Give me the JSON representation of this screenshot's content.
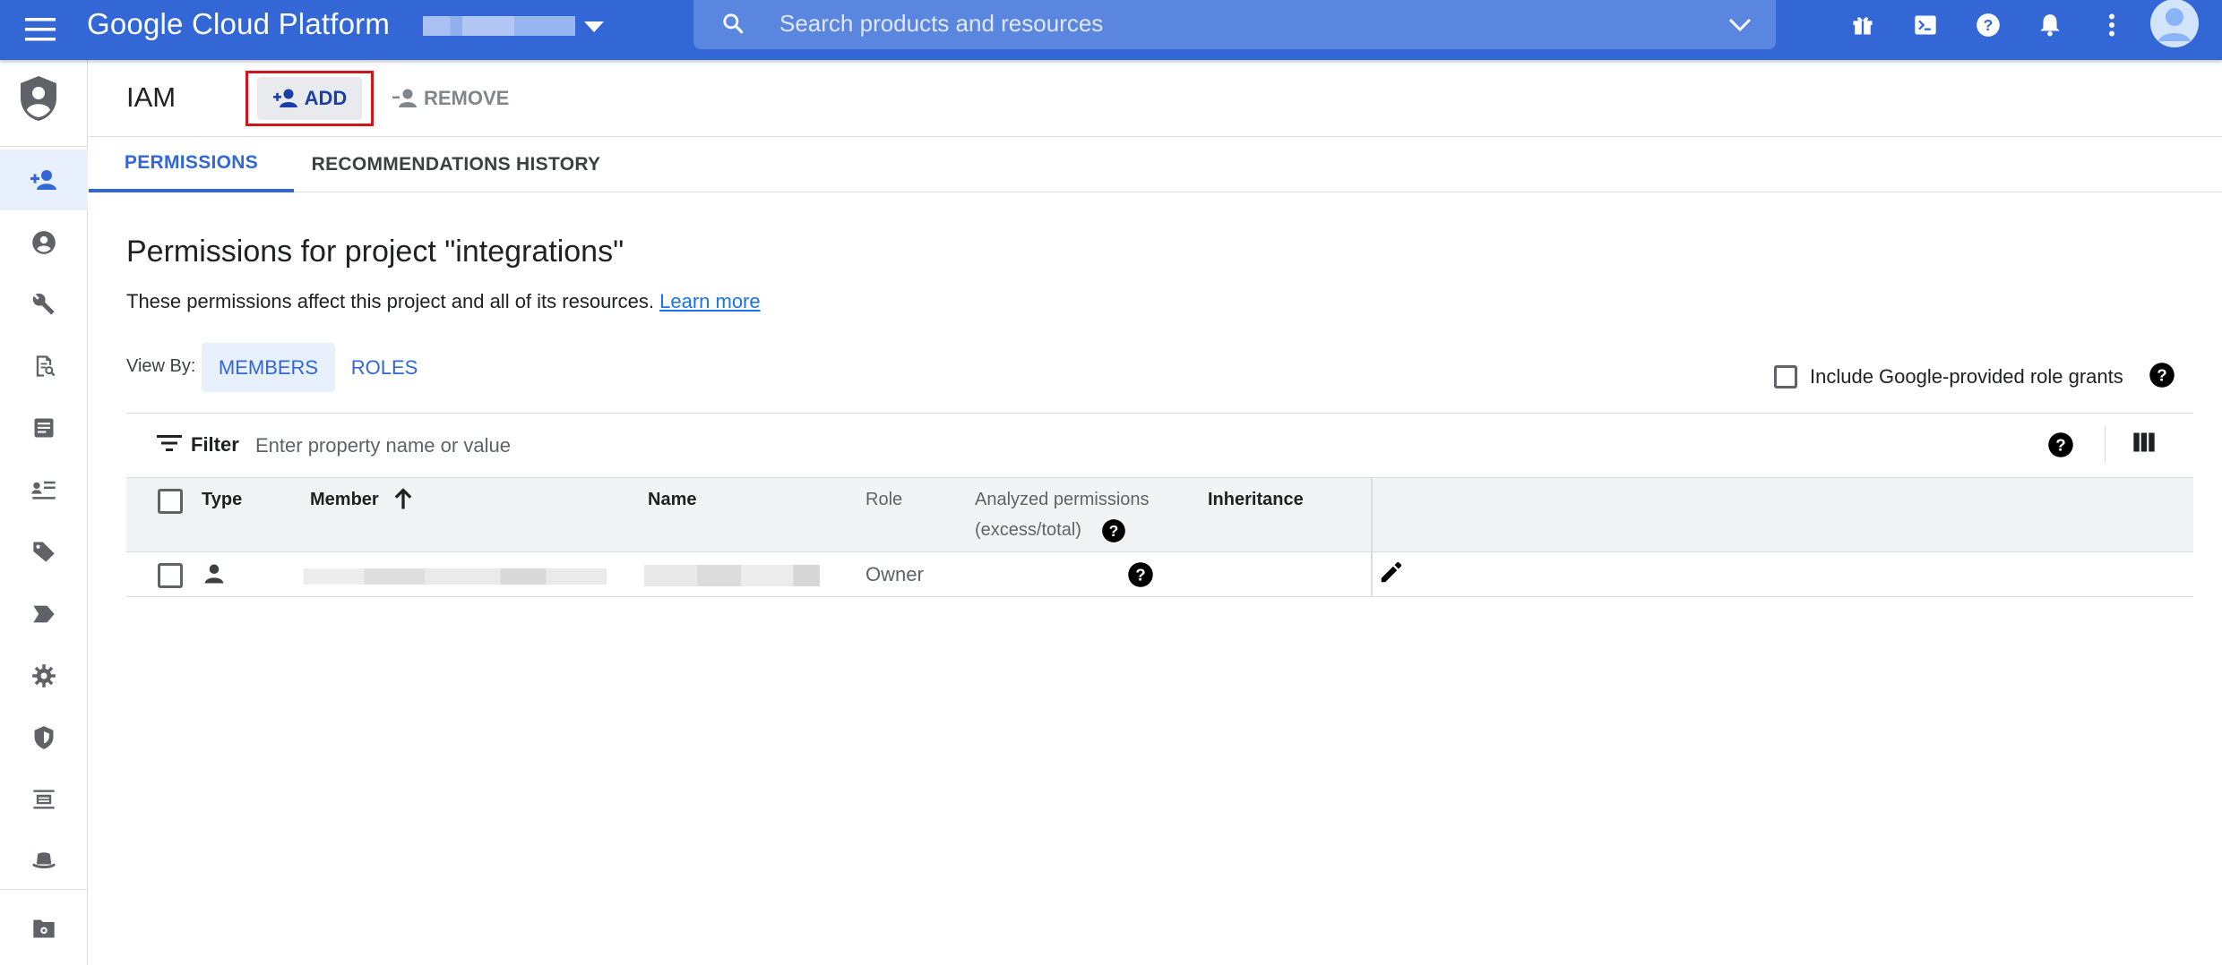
{
  "topbar": {
    "brand": "Google Cloud Platform",
    "search_placeholder": "Search products and resources"
  },
  "actions": {
    "page_title": "IAM",
    "add_label": "ADD",
    "remove_label": "REMOVE"
  },
  "tabs": [
    {
      "label": "PERMISSIONS",
      "active": true
    },
    {
      "label": "RECOMMENDATIONS HISTORY",
      "active": false
    }
  ],
  "content": {
    "heading": "Permissions for project \"integrations\"",
    "description": "These permissions affect this project and all of its resources.",
    "learn_more": "Learn more",
    "view_by_label": "View By:",
    "view_by_options": [
      "MEMBERS",
      "ROLES"
    ],
    "view_by_selected": "MEMBERS",
    "include_label": "Include Google-provided role grants",
    "include_checked": false
  },
  "filter": {
    "label": "Filter",
    "placeholder": "Enter property name or value"
  },
  "table": {
    "columns": {
      "type": "Type",
      "member": "Member",
      "name": "Name",
      "role": "Role",
      "analyzed_line1": "Analyzed permissions",
      "analyzed_line2": "(excess/total)",
      "inheritance": "Inheritance"
    },
    "sort_column": "Member",
    "sort_direction": "ascending",
    "rows": [
      {
        "type_icon": "person-icon",
        "role": "Owner"
      }
    ]
  },
  "colors": {
    "topbar": "#3367d6",
    "accent": "#3367d6",
    "highlight_box": "#d0161b"
  }
}
